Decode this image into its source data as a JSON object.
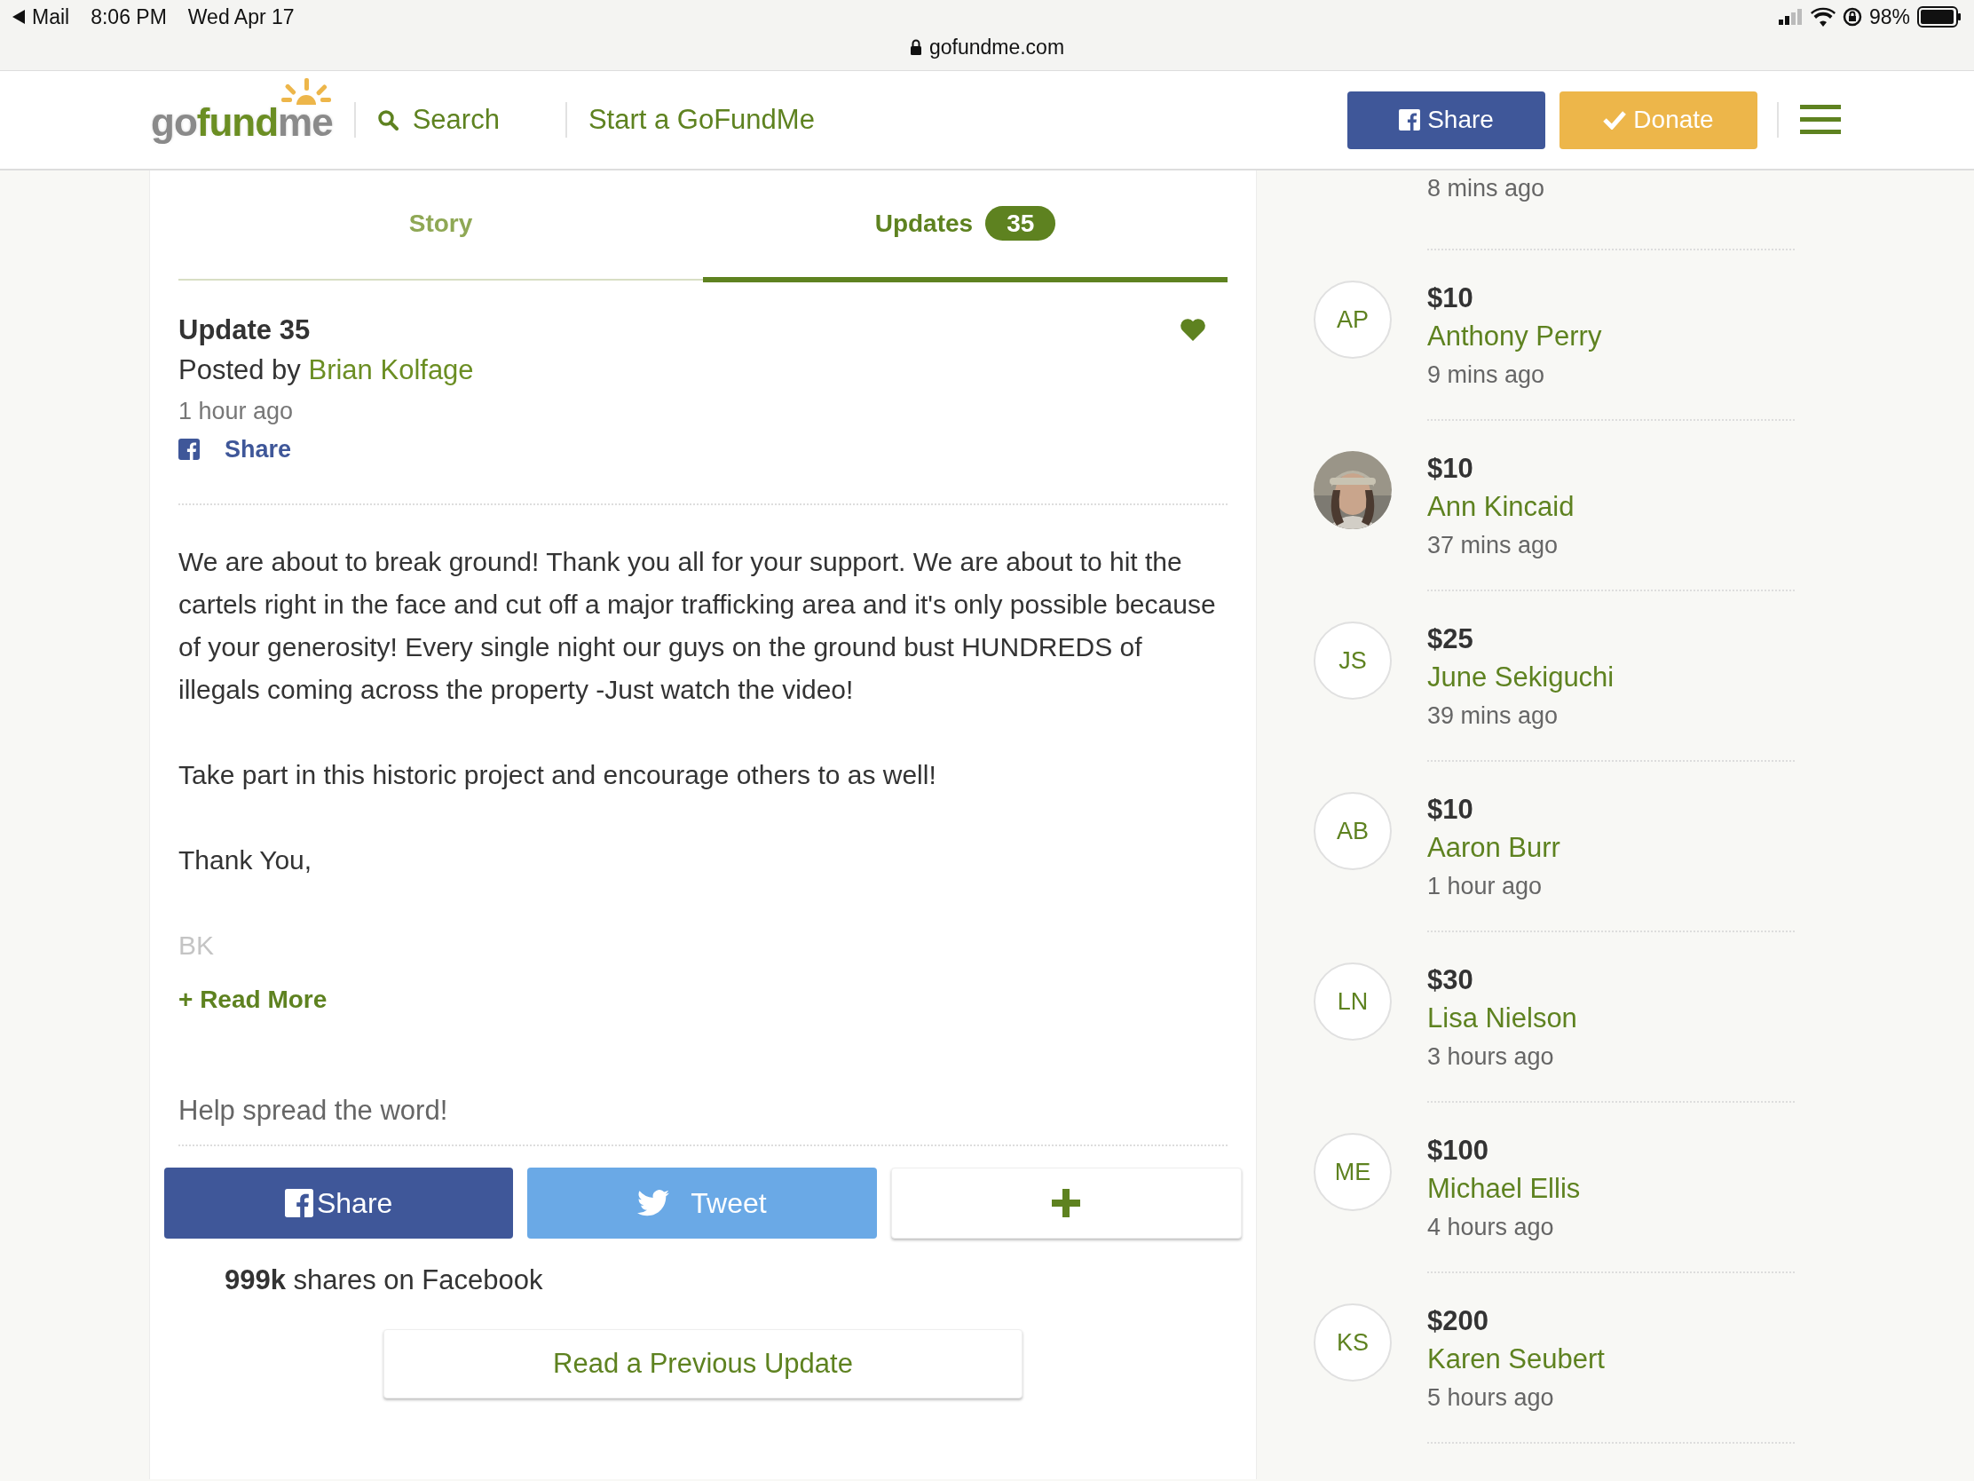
{
  "status_bar": {
    "back_app": "Mail",
    "time": "8:06 PM",
    "date": "Wed Apr 17",
    "url": "gofundme.com",
    "battery": "98%"
  },
  "navbar": {
    "logo": [
      {
        "text": "go",
        "kind": "gray"
      },
      {
        "text": "fund",
        "kind": "green"
      },
      {
        "text": "me",
        "kind": "gray"
      }
    ],
    "search": "Search",
    "start": "Start a GoFundMe",
    "share": "Share",
    "donate": "Donate"
  },
  "tabs": [
    {
      "label": "Story",
      "selected": false
    },
    {
      "label": "Updates",
      "badge": "35",
      "selected": true
    }
  ],
  "update": {
    "title": "Update 35",
    "posted_by": "Posted by",
    "author": "Brian Kolfage",
    "time": "1 hour ago",
    "share": "Share",
    "paragraphs": [
      "We are about to break ground! Thank you all for your support. We are about to hit the cartels right in the face and cut off a major trafficking area and it's only possible because of your generosity! Every single night our guys on the ground bust HUNDREDS of illegals coming across the property -Just watch the video!",
      "Take part in this historic project and encourage others to as well!",
      "Thank You,"
    ],
    "signature": "BK",
    "read_more": "+ Read More"
  },
  "share_section": {
    "prompt": "Help spread the word!",
    "buttons": [
      {
        "kind": "facebook",
        "label": "Share"
      },
      {
        "kind": "twitter",
        "label": "Tweet"
      },
      {
        "kind": "more"
      }
    ],
    "shares": "**999k** shares on Facebook",
    "previous": "Read a Previous Update"
  },
  "donations": [
    {
      "kind": "partial",
      "time": "8 mins ago"
    },
    {
      "kind": "initials",
      "initials": "AP",
      "amount": "$10",
      "name": "Anthony Perry",
      "time": "9 mins ago"
    },
    {
      "kind": "picture",
      "amount": "$10",
      "name": "Ann Kincaid",
      "time": "37 mins ago"
    },
    {
      "kind": "initials",
      "initials": "JS",
      "amount": "$25",
      "name": "June Sekiguchi",
      "time": "39 mins ago"
    },
    {
      "kind": "initials",
      "initials": "AB",
      "amount": "$10",
      "name": "Aaron Burr",
      "time": "1 hour ago"
    },
    {
      "kind": "initials",
      "initials": "LN",
      "amount": "$30",
      "name": "Lisa Nielson",
      "time": "3 hours ago"
    },
    {
      "kind": "initials",
      "initials": "ME",
      "amount": "$100",
      "name": "Michael Ellis",
      "time": "4 hours ago"
    },
    {
      "kind": "initials",
      "initials": "KS",
      "amount": "$200",
      "name": "Karen Seubert",
      "time": "5 hours ago"
    }
  ]
}
